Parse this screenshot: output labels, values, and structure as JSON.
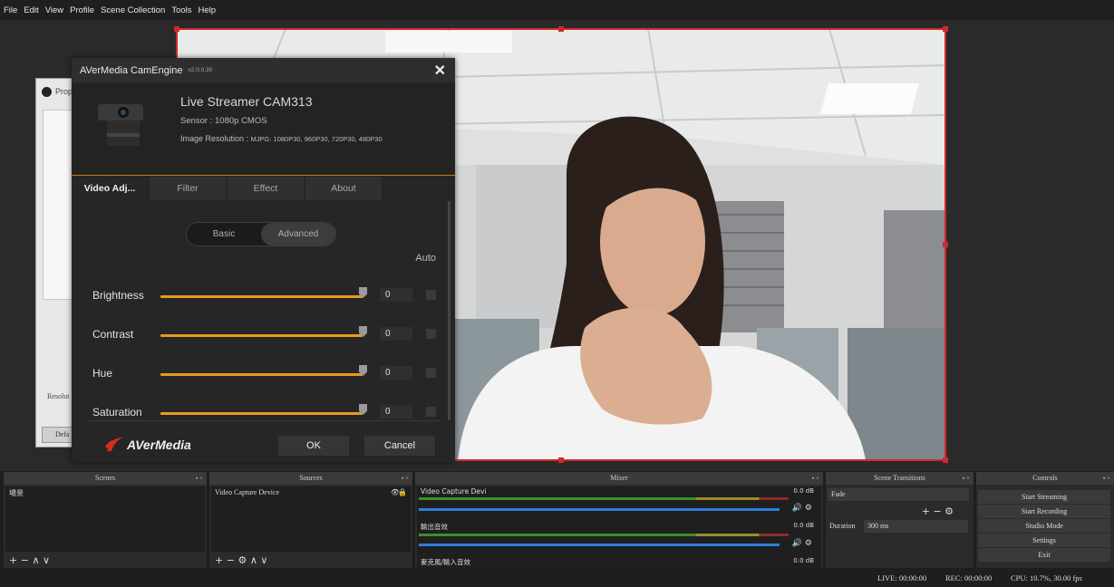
{
  "menu": [
    "File",
    "Edit",
    "View",
    "Profile",
    "Scene Collection",
    "Tools",
    "Help"
  ],
  "properties": {
    "title": "Prop",
    "resolution_label": "Resolut",
    "defaults_label": "Defa"
  },
  "camengine": {
    "title": "AVerMedia CamEngine",
    "version": "v2.0.0.30",
    "device_name": "Live Streamer CAM313",
    "sensor": "Sensor : 1080p CMOS",
    "resolution_prefix": "Image Resolution : ",
    "resolution_values": "MJPG: 1080P30, 960P30, 720P30, 480P30",
    "tabs": [
      "Video Adj...",
      "Filter",
      "Effect",
      "About"
    ],
    "modes": [
      "Basic",
      "Advanced"
    ],
    "auto_label": "Auto",
    "controls": [
      {
        "label": "Brightness",
        "value": "0"
      },
      {
        "label": "Contrast",
        "value": "0"
      },
      {
        "label": "Hue",
        "value": "0"
      },
      {
        "label": "Saturation",
        "value": "0"
      }
    ],
    "brand": "AVerMedia",
    "ok_label": "OK",
    "cancel_label": "Cancel"
  },
  "docks": {
    "scenes": {
      "title": "Scenes",
      "items": [
        "場景"
      ]
    },
    "sources": {
      "title": "Sources",
      "items": [
        "Video Capture Device"
      ]
    },
    "mixer": {
      "title": "Mixer",
      "channels": [
        {
          "name": "Video Capture Devi",
          "db": "0.0 dB"
        },
        {
          "name": "輸出音效",
          "db": "0.0 dB"
        },
        {
          "name": "麥克風/輸入音效",
          "db": "0.0 dB"
        }
      ]
    },
    "transitions": {
      "title": "Scene Transitions",
      "transition": "Fade",
      "duration_label": "Duration",
      "duration_value": "300 ms"
    },
    "controls": {
      "title": "Controls",
      "buttons": [
        "Start Streaming",
        "Start Recording",
        "Studio Mode",
        "Settings",
        "Exit"
      ]
    }
  },
  "status": {
    "live": "LIVE: 00:00:00",
    "rec": "REC: 00:00:00",
    "cpu": "CPU: 10.7%, 30.00 fps"
  },
  "colors": {
    "accent": "#e89a1e",
    "selection": "#d2282a",
    "brand_red": "#d92b25"
  }
}
